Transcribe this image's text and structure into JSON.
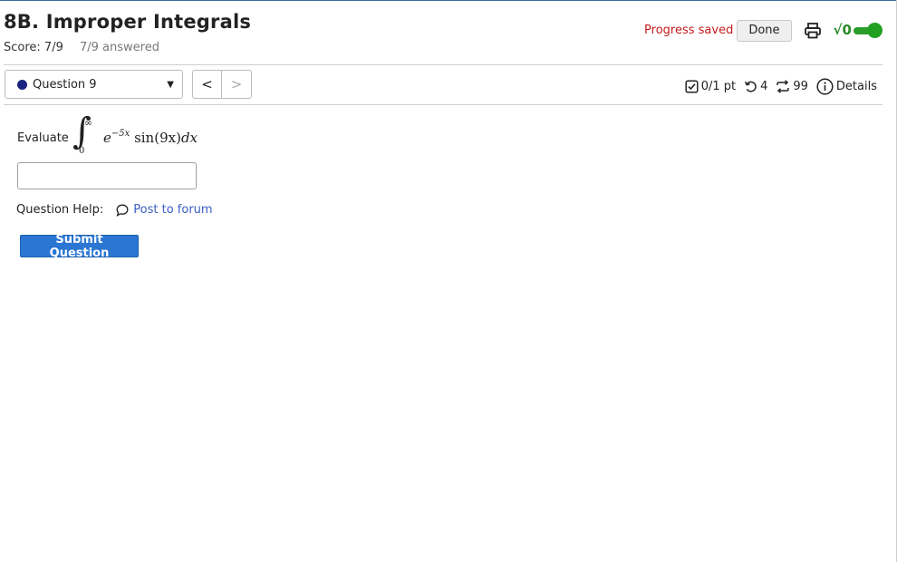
{
  "header": {
    "title": "8B. Improper Integrals",
    "score": "Score: 7/9",
    "answered": "7/9 answered",
    "progress_status": "Progress saved",
    "done_label": "Done",
    "math_toggle_label": "√0",
    "math_toggle_on": true
  },
  "question_nav": {
    "selected_question": "Question 9",
    "prev_symbol": "<",
    "next_symbol": ">"
  },
  "meta": {
    "points": "0/1 pt",
    "retries": "4",
    "attempts": "99",
    "details_label": "Details"
  },
  "question": {
    "prompt": "Evaluate",
    "integral": {
      "upper_limit": "∞",
      "lower_limit": "0",
      "base": "e",
      "exponent": "−5x",
      "function": "sin(9x)",
      "differential": "dx"
    },
    "answer_value": "",
    "answer_placeholder": ""
  },
  "help": {
    "label": "Question Help:",
    "forum_link": "Post to forum"
  },
  "submit_label": "Submit Question",
  "colors": {
    "progress_saved": "#c41a1a",
    "submit_button": "#2a76d2",
    "link": "#3a5ec2",
    "toggle_on": "#2b9d2b",
    "question_dot": "#1a237e"
  },
  "icons": [
    "printer-icon",
    "sqrt-icon",
    "toggle-switch",
    "checkbox-icon",
    "retry-icon",
    "attempts-icon",
    "info-icon",
    "chat-bubble-icon",
    "dropdown-caret-icon"
  ]
}
